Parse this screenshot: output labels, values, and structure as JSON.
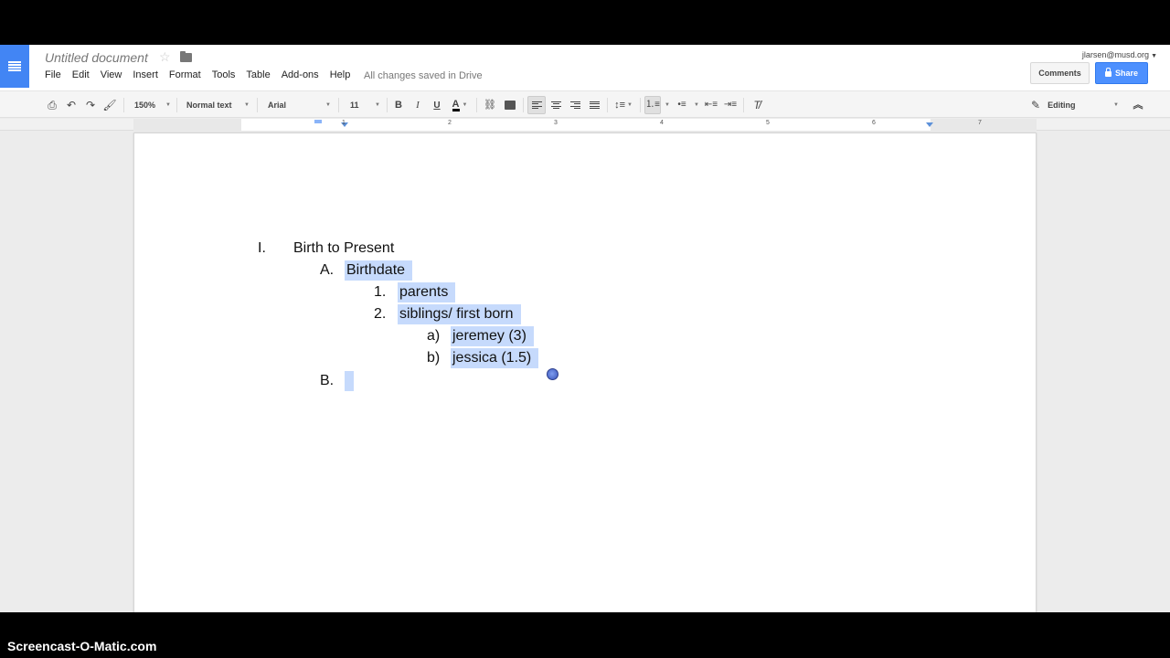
{
  "doc": {
    "title": "Untitled document",
    "saved_status": "All changes saved in Drive",
    "account": "jlarsen@musd.org"
  },
  "menu": [
    "File",
    "Edit",
    "View",
    "Insert",
    "Format",
    "Tools",
    "Table",
    "Add-ons",
    "Help"
  ],
  "buttons": {
    "comments": "Comments",
    "share": "Share"
  },
  "toolbar": {
    "zoom": "150%",
    "style": "Normal text",
    "font": "Arial",
    "size": "11",
    "bold": "B",
    "italic": "I",
    "underline": "U",
    "text_color": "A",
    "mode": "Editing"
  },
  "ruler": {
    "numbers": [
      "1",
      "2",
      "3",
      "4",
      "5",
      "6",
      "7"
    ]
  },
  "outline": [
    {
      "marker": "I.",
      "text": "Birth to Present"
    },
    {
      "marker": "A.",
      "text": "Birthdate"
    },
    {
      "marker": "1.",
      "text": "parents"
    },
    {
      "marker": "2.",
      "text": "siblings/ first born"
    },
    {
      "marker": "a)",
      "text": "jeremey (3)"
    },
    {
      "marker": "b)",
      "text": "jessica (1.5)"
    },
    {
      "marker": "B.",
      "text": ""
    }
  ],
  "colors": {
    "accent": "#4285f4",
    "share": "#4d90fe",
    "selection": "#c6dafc"
  },
  "footer": {
    "watermark": "Screencast-O-Matic.com"
  }
}
